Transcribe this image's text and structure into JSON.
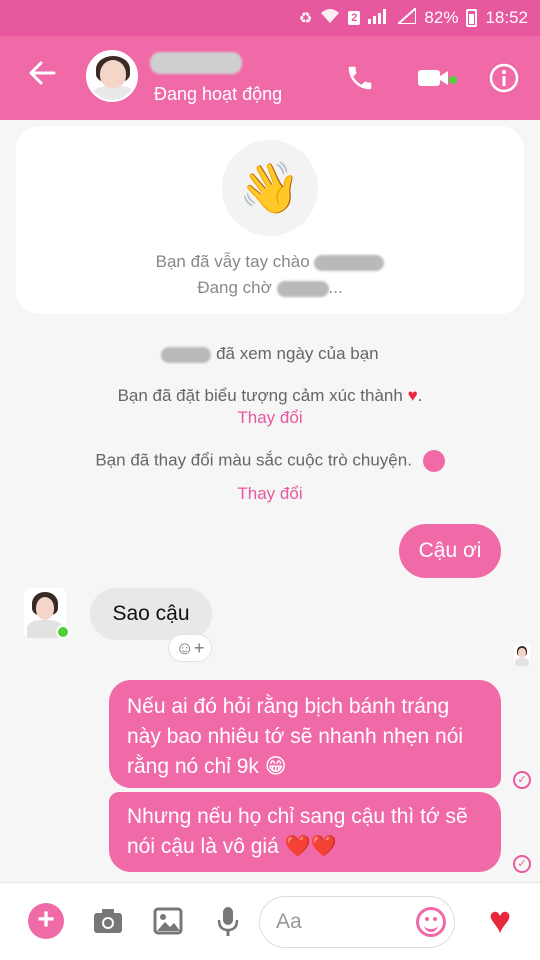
{
  "status_bar": {
    "sim_badge": "2",
    "battery": "82%",
    "time": "18:52"
  },
  "header": {
    "status": "Đang hoạt động"
  },
  "wave_card": {
    "line1": "Bạn đã vẫy tay chào",
    "line2_prefix": "Đang chờ",
    "line2_suffix": "..."
  },
  "system": {
    "seen_day": "đã xem ngày của bạn",
    "set_emoji": "Bạn đã đặt biểu tượng cảm xúc thành",
    "set_emoji_end": ".",
    "change_link_1": "Thay đổi",
    "changed_color": "Bạn đã thay đổi màu sắc cuộc trò chuyện.",
    "change_link_2": "Thay đổi"
  },
  "messages": {
    "out_1": "Cậu ơi",
    "in_1": "Sao cậu",
    "out_2": "Nếu ai đó hỏi rằng bịch bánh tráng này bao nhiêu tớ sẽ nhanh nhẹn nói rằng nó chỉ 9k 😁",
    "out_3": "Nhưng nếu họ chỉ sang cậu thì tớ sẽ nói cậu là vô giá ❤️❤️"
  },
  "composer": {
    "placeholder": "Aa"
  },
  "colors": {
    "accent": "#f06aa8",
    "status_bar": "#e8589f",
    "online": "#4cd137",
    "heart": "#e8283c"
  }
}
